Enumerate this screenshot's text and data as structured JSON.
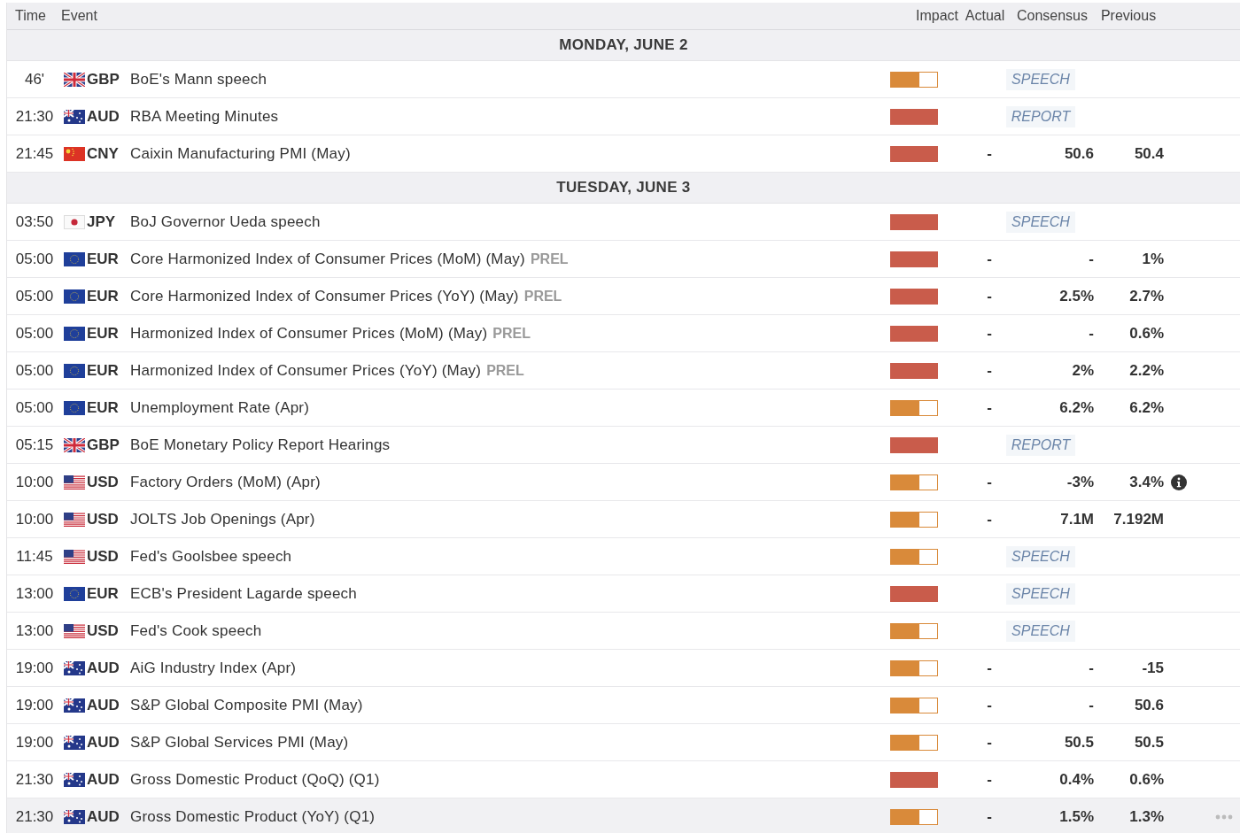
{
  "table": {
    "columns": [
      "Time",
      "Event",
      "Impact",
      "Actual",
      "Consensus",
      "Previous"
    ],
    "days": [
      {
        "title": "MONDAY, JUNE 2",
        "rows": [
          {
            "time": "46'",
            "flag": {
              "kind": "uk"
            },
            "currency": "GBP",
            "event": "BoE's Mann speech",
            "impact": {
              "kind": "medium"
            },
            "tag": "SPEECH",
            "highlighted": false,
            "info": false
          },
          {
            "time": "21:30",
            "flag": {
              "kind": "au"
            },
            "currency": "AUD",
            "event": "RBA Meeting Minutes",
            "impact": {
              "kind": "high"
            },
            "tag": "REPORT",
            "highlighted": false,
            "info": false
          },
          {
            "time": "21:45",
            "flag": {
              "kind": "cn"
            },
            "currency": "CNY",
            "event": "Caixin Manufacturing PMI (May)",
            "impact": {
              "kind": "high"
            },
            "actual": "-",
            "consensus": "50.6",
            "previous": "50.4",
            "highlighted": false,
            "info": false
          }
        ]
      },
      {
        "title": "TUESDAY, JUNE 3",
        "rows": [
          {
            "time": "03:50",
            "flag": {
              "kind": "jp"
            },
            "currency": "JPY",
            "event": "BoJ Governor Ueda speech",
            "impact": {
              "kind": "high"
            },
            "tag": "SPEECH",
            "highlighted": false,
            "info": false
          },
          {
            "time": "05:00",
            "flag": {
              "kind": "eu"
            },
            "currency": "EUR",
            "event": "Core Harmonized Index of Consumer Prices (MoM) (May)",
            "suffix": "PREL",
            "impact": {
              "kind": "high"
            },
            "actual": "-",
            "consensus": "-",
            "previous": "1%",
            "highlighted": false,
            "info": false
          },
          {
            "time": "05:00",
            "flag": {
              "kind": "eu"
            },
            "currency": "EUR",
            "event": "Core Harmonized Index of Consumer Prices (YoY) (May)",
            "suffix": "PREL",
            "impact": {
              "kind": "high"
            },
            "actual": "-",
            "consensus": "2.5%",
            "previous": "2.7%",
            "highlighted": false,
            "info": false
          },
          {
            "time": "05:00",
            "flag": {
              "kind": "eu"
            },
            "currency": "EUR",
            "event": "Harmonized Index of Consumer Prices (MoM) (May)",
            "suffix": "PREL",
            "impact": {
              "kind": "high"
            },
            "actual": "-",
            "consensus": "-",
            "previous": "0.6%",
            "highlighted": false,
            "info": false
          },
          {
            "time": "05:00",
            "flag": {
              "kind": "eu"
            },
            "currency": "EUR",
            "event": "Harmonized Index of Consumer Prices (YoY) (May)",
            "suffix": "PREL",
            "impact": {
              "kind": "high"
            },
            "actual": "-",
            "consensus": "2%",
            "previous": "2.2%",
            "highlighted": false,
            "info": false
          },
          {
            "time": "05:00",
            "flag": {
              "kind": "eu"
            },
            "currency": "EUR",
            "event": "Unemployment Rate (Apr)",
            "impact": {
              "kind": "medium"
            },
            "actual": "-",
            "consensus": "6.2%",
            "previous": "6.2%",
            "highlighted": false,
            "info": false
          },
          {
            "time": "05:15",
            "flag": {
              "kind": "uk"
            },
            "currency": "GBP",
            "event": "BoE Monetary Policy Report Hearings",
            "impact": {
              "kind": "high"
            },
            "tag": "REPORT",
            "highlighted": false,
            "info": false
          },
          {
            "time": "10:00",
            "flag": {
              "kind": "us"
            },
            "currency": "USD",
            "event": "Factory Orders (MoM) (Apr)",
            "impact": {
              "kind": "medium"
            },
            "actual": "-",
            "consensus": "-3%",
            "previous": "3.4%",
            "highlighted": false,
            "info": true
          },
          {
            "time": "10:00",
            "flag": {
              "kind": "us"
            },
            "currency": "USD",
            "event": "JOLTS Job Openings (Apr)",
            "impact": {
              "kind": "medium"
            },
            "actual": "-",
            "consensus": "7.1M",
            "previous": "7.192M",
            "highlighted": false,
            "info": false
          },
          {
            "time": "11:45",
            "flag": {
              "kind": "us"
            },
            "currency": "USD",
            "event": "Fed's Goolsbee speech",
            "impact": {
              "kind": "medium"
            },
            "tag": "SPEECH",
            "highlighted": false,
            "info": false
          },
          {
            "time": "13:00",
            "flag": {
              "kind": "eu"
            },
            "currency": "EUR",
            "event": "ECB's President Lagarde speech",
            "impact": {
              "kind": "high"
            },
            "tag": "SPEECH",
            "highlighted": false,
            "info": false
          },
          {
            "time": "13:00",
            "flag": {
              "kind": "us"
            },
            "currency": "USD",
            "event": "Fed's Cook speech",
            "impact": {
              "kind": "medium"
            },
            "tag": "SPEECH",
            "highlighted": false,
            "info": false
          },
          {
            "time": "19:00",
            "flag": {
              "kind": "au"
            },
            "currency": "AUD",
            "event": "AiG Industry Index (Apr)",
            "impact": {
              "kind": "medium"
            },
            "actual": "-",
            "consensus": "-",
            "previous": "-15",
            "highlighted": false,
            "info": false
          },
          {
            "time": "19:00",
            "flag": {
              "kind": "au"
            },
            "currency": "AUD",
            "event": "S&P Global Composite PMI (May)",
            "impact": {
              "kind": "medium"
            },
            "actual": "-",
            "consensus": "-",
            "previous": "50.6",
            "highlighted": false,
            "info": false
          },
          {
            "time": "19:00",
            "flag": {
              "kind": "au"
            },
            "currency": "AUD",
            "event": "S&P Global Services PMI (May)",
            "impact": {
              "kind": "medium"
            },
            "actual": "-",
            "consensus": "50.5",
            "previous": "50.5",
            "highlighted": false,
            "info": false
          },
          {
            "time": "21:30",
            "flag": {
              "kind": "au"
            },
            "currency": "AUD",
            "event": "Gross Domestic Product (QoQ) (Q1)",
            "impact": {
              "kind": "high"
            },
            "actual": "-",
            "consensus": "0.4%",
            "previous": "0.6%",
            "highlighted": false,
            "info": false
          },
          {
            "time": "21:30",
            "flag": {
              "kind": "au"
            },
            "currency": "AUD",
            "event": "Gross Domestic Product (YoY) (Q1)",
            "impact": {
              "kind": "medium"
            },
            "actual": "-",
            "consensus": "1.5%",
            "previous": "1.3%",
            "highlighted": true,
            "info": false
          }
        ]
      }
    ]
  }
}
